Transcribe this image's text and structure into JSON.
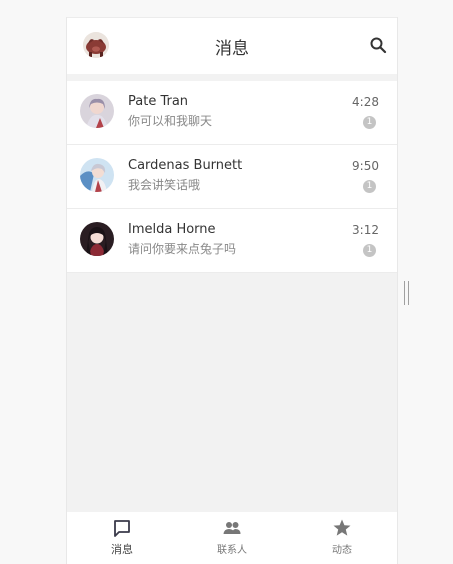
{
  "header": {
    "title": "消息",
    "avatar_icon": "pig-avatar-icon",
    "search_icon": "search-icon"
  },
  "conversations": [
    {
      "name": "Pate Tran",
      "message": "你可以和我聊天",
      "time": "4:28",
      "unread": "1"
    },
    {
      "name": "Cardenas Burnett",
      "message": "我会讲笑话哦",
      "time": "9:50",
      "unread": "1"
    },
    {
      "name": "Imelda Horne",
      "message": "请问你要来点兔子吗",
      "time": "3:12",
      "unread": "1"
    }
  ],
  "tabbar": {
    "tabs": [
      {
        "label": "消息",
        "icon": "chat-bubble-icon",
        "active": true
      },
      {
        "label": "联系人",
        "icon": "people-icon",
        "active": false
      },
      {
        "label": "动态",
        "icon": "star-icon",
        "active": false
      }
    ]
  },
  "colors": {
    "background": "#f8f8f8",
    "panel": "#ffffff",
    "content_bg": "#f2f2f2",
    "badge": "#c4c4c4",
    "text_primary": "#333333",
    "text_secondary": "#888888"
  }
}
